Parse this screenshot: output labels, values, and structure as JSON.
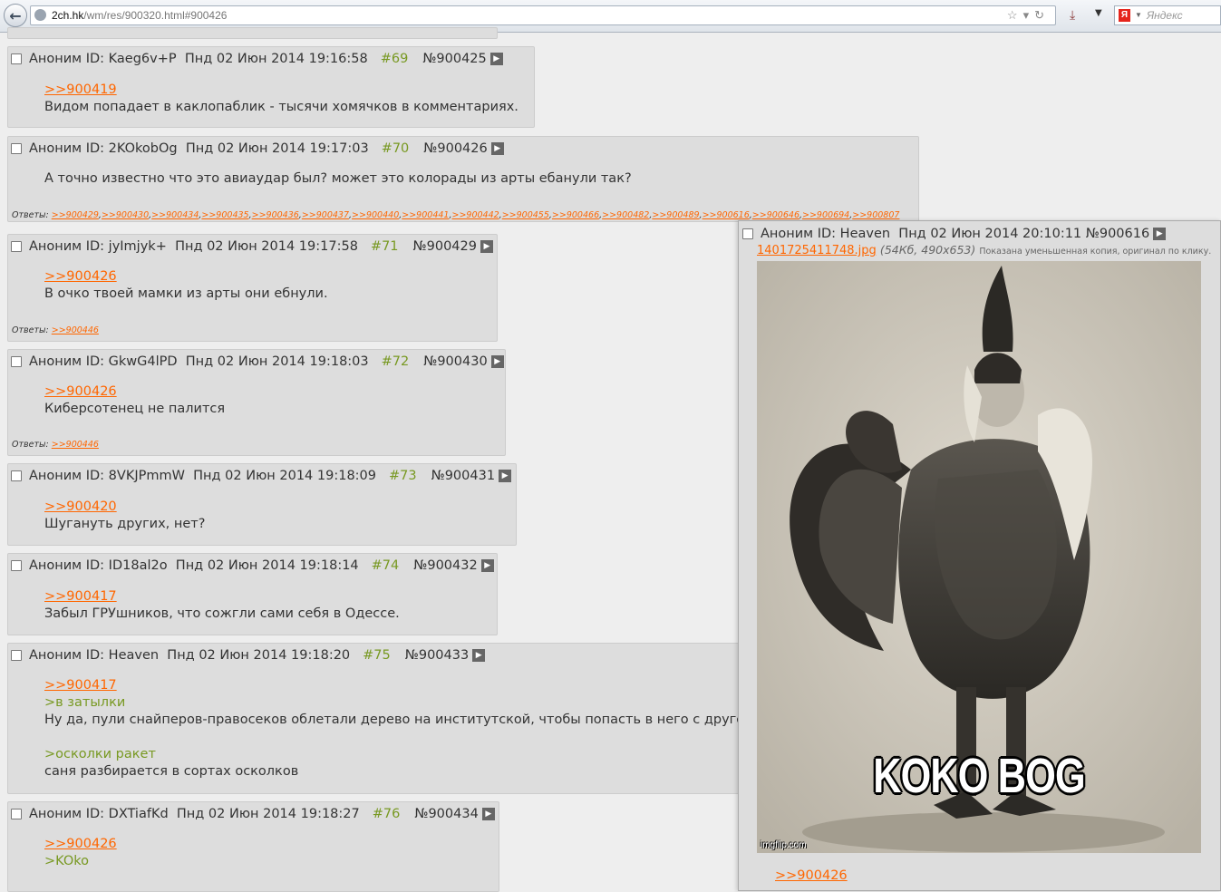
{
  "browser": {
    "url_domain": "2ch.hk",
    "url_path": "/wm/res/900320.html#900426",
    "search_placeholder": "Яндекс",
    "ya_logo": "Я"
  },
  "posts": [
    {
      "name": "Аноним",
      "id": "ID: Kaeg6v+P",
      "date": "Пнд 02 Июн 2014 19:16:58",
      "num": "#69",
      "no": "№900425",
      "ref": ">>900419",
      "lines": [
        "Видом попадает в каклопаблик - тысячи хомячков в комментариях."
      ]
    },
    {
      "name": "Аноним",
      "id": "ID: 2KOkobOg",
      "date": "Пнд 02 Июн 2014 19:17:03",
      "num": "#70",
      "no": "№900426",
      "lines": [
        "А точно известно что это авиаудар был? может это колорады из арты ебанули так?"
      ],
      "answers_label": "Ответы:",
      "answers": [
        ">>900429",
        ">>900430",
        ">>900434",
        ">>900435",
        ">>900436",
        ">>900437",
        ">>900440",
        ">>900441",
        ">>900442",
        ">>900455",
        ">>900466",
        ">>900482",
        ">>900489",
        ">>900616",
        ">>900646",
        ">>900694",
        ">>900807"
      ]
    },
    {
      "name": "Аноним",
      "id": "ID: jyImjyk+",
      "date": "Пнд 02 Июн 2014 19:17:58",
      "num": "#71",
      "no": "№900429",
      "ref": ">>900426",
      "lines": [
        "В очко твоей мамки из арты они ебнули."
      ],
      "answers_label": "Ответы:",
      "answers": [
        ">>900446"
      ]
    },
    {
      "name": "Аноним",
      "id": "ID: GkwG4lPD",
      "date": "Пнд 02 Июн 2014 19:18:03",
      "num": "#72",
      "no": "№900430",
      "ref": ">>900426",
      "lines": [
        "Киберсотенец не палится"
      ],
      "answers_label": "Ответы:",
      "answers": [
        ">>900446"
      ]
    },
    {
      "name": "Аноним",
      "id": "ID: 8VKJPmmW",
      "date": "Пнд 02 Июн 2014 19:18:09",
      "num": "#73",
      "no": "№900431",
      "ref": ">>900420",
      "lines": [
        "Шугануть других, нет?"
      ]
    },
    {
      "name": "Аноним",
      "id": "ID: ID18al2o",
      "date": "Пнд 02 Июн 2014 19:18:14",
      "num": "#74",
      "no": "№900432",
      "ref": ">>900417",
      "lines": [
        "Забыл ГРУшников, что сожгли сами себя в Одессе."
      ]
    },
    {
      "name": "Аноним",
      "id": "ID: Heaven",
      "date": "Пнд 02 Июн 2014 19:18:20",
      "num": "#75",
      "no": "№900433",
      "ref": ">>900417",
      "quote1": ">в затылки",
      "line1": "Ну да, пули снайперов-правосеков облетали дерево на институтской, чтобы попасть в него с другой ст",
      "quote2": ">осколки ракет",
      "line2": "саня разбирается в сортах осколков"
    },
    {
      "name": "Аноним",
      "id": "ID: DXTiafKd",
      "date": "Пнд 02 Июн 2014 19:18:27",
      "num": "#76",
      "no": "№900434",
      "ref": ">>900426",
      "quote1": ">KOko"
    }
  ],
  "popup": {
    "name": "Аноним",
    "id": "ID: Heaven",
    "date": "Пнд 02 Июн 2014 20:10:11",
    "no": "№900616",
    "file_name": "1401725411748.jpg",
    "file_meta": "54Кб, 490x653",
    "file_note": "Показана уменьшенная копия, оригинал по клику.",
    "image_caption": "KOKO BOG",
    "watermark": "imgflip.com",
    "ref": ">>900426"
  }
}
